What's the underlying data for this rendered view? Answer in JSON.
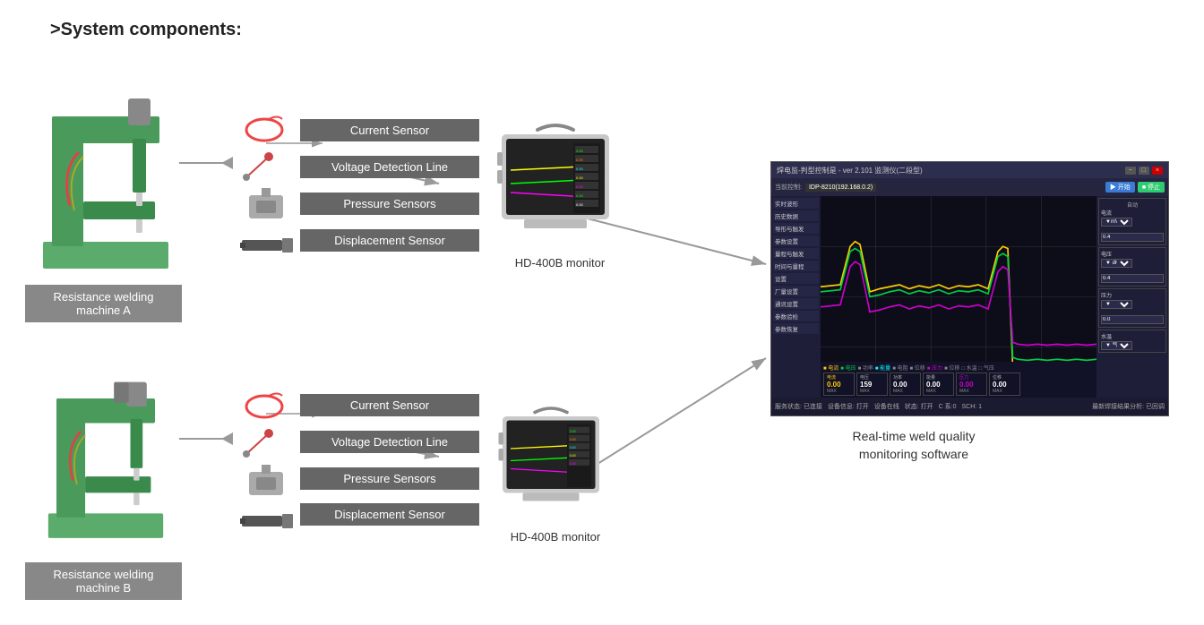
{
  "title": ">System components:",
  "machines": [
    {
      "id": "machine-a",
      "label": "Resistance welding\nmachine A"
    },
    {
      "id": "machine-b",
      "label": "Resistance welding\nmachine B"
    }
  ],
  "sensors_top": [
    {
      "id": "current-sensor-a",
      "label": "Current Sensor"
    },
    {
      "id": "voltage-sensor-a",
      "label": "Voltage Detection Line"
    },
    {
      "id": "pressure-sensor-a",
      "label": "Pressure Sensors"
    },
    {
      "id": "displacement-sensor-a",
      "label": "Displacement Sensor"
    }
  ],
  "sensors_bottom": [
    {
      "id": "current-sensor-b",
      "label": "Current Sensor"
    },
    {
      "id": "voltage-sensor-b",
      "label": "Voltage Detection Line"
    },
    {
      "id": "pressure-sensor-b",
      "label": "Pressure Sensors"
    },
    {
      "id": "displacement-sensor-b",
      "label": "Displacement Sensor"
    }
  ],
  "monitor_top": {
    "label": "HD-400B monitor"
  },
  "monitor_bottom": {
    "label": "HD-400B monitor"
  },
  "software": {
    "label": "Real-time weld quality\nmonitoring software",
    "titlebar": "焊电监-判型控制是 - ver 2.101 监测仪(二段型)",
    "device": "IDP-8210(192.168.0.2)"
  },
  "colors": {
    "sensor_box_bg": "#666666",
    "machine_box_bg": "#888888",
    "arrow_color": "#999999"
  }
}
